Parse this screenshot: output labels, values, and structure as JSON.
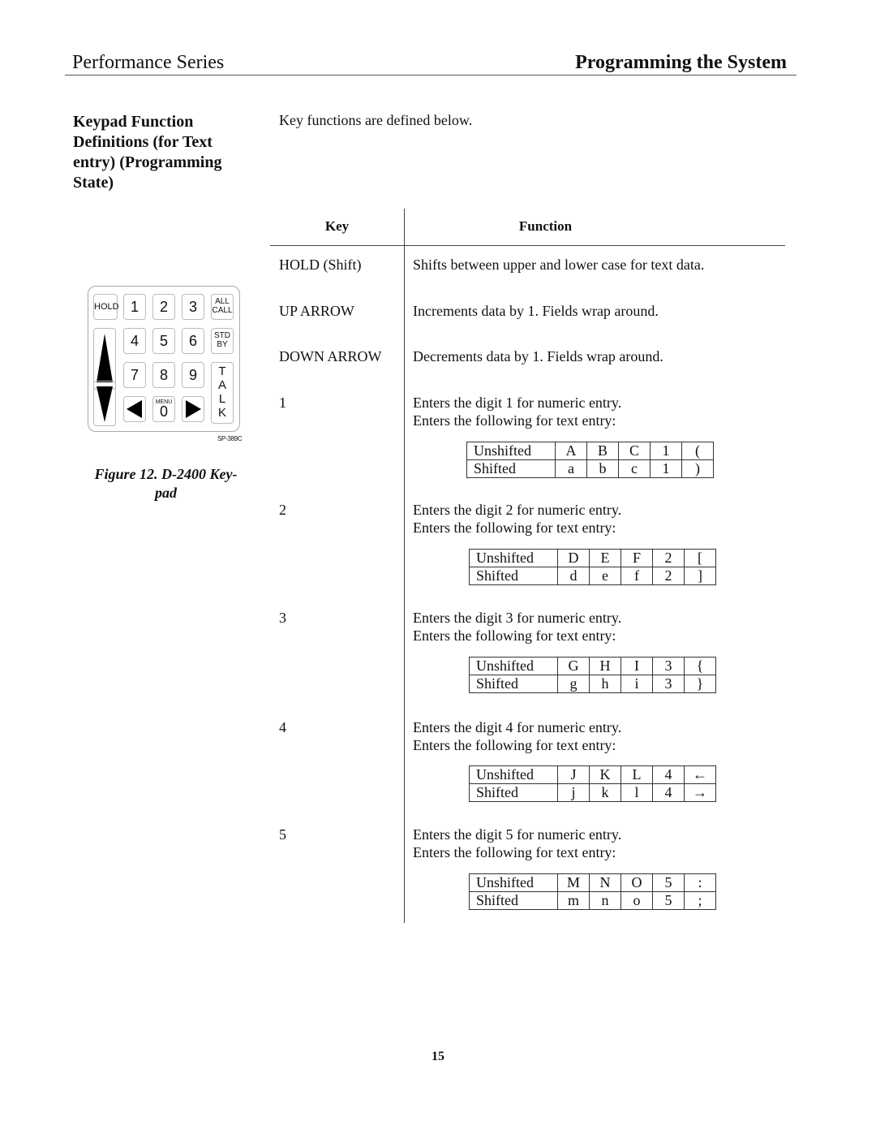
{
  "header": {
    "left": "Performance Series",
    "right": "Programming the System"
  },
  "section": {
    "title": "Keypad Function Definitions (for Text entry) (Programming State)",
    "intro": "Key functions are defined below."
  },
  "figure": {
    "caption_line1": "Figure 12.  D-2400 Key-",
    "caption_line2": "pad",
    "code": "SP-389C",
    "keys": {
      "hold": "HOLD",
      "d1": "1",
      "d2": "2",
      "d3": "3",
      "allcall_1": "ALL",
      "allcall_2": "CALL",
      "d4": "4",
      "d5": "5",
      "d6": "6",
      "stdby_1": "STD",
      "stdby_2": "BY",
      "d7": "7",
      "d8": "8",
      "d9": "9",
      "talk": [
        "T",
        "A",
        "L",
        "K"
      ],
      "menu": "MENU",
      "d0": "0"
    }
  },
  "table": {
    "col_key": "Key",
    "col_function": "Function",
    "rows": [
      {
        "key": "HOLD (Shift)",
        "function": "Shifts between upper and lower case for text data."
      },
      {
        "key": "UP ARROW",
        "function": "Increments data by 1.  Fields wrap around."
      },
      {
        "key": "DOWN ARROW",
        "function": "Decrements data by 1.  Fields wrap around."
      },
      {
        "key": "1",
        "function": "Enters the digit 1 for numeric entry.",
        "function2": "Enters the following for text entry:",
        "chars": {
          "unshifted": [
            "A",
            "B",
            "C",
            "1",
            "("
          ],
          "shifted": [
            "a",
            "b",
            "c",
            "1",
            ")"
          ]
        }
      },
      {
        "key": "2",
        "function": "Enters the digit 2 for numeric entry.",
        "function2": "Enters the following for text entry:",
        "chars": {
          "unshifted": [
            "D",
            "E",
            "F",
            "2",
            "["
          ],
          "shifted": [
            "d",
            "e",
            "f",
            "2",
            "]"
          ]
        }
      },
      {
        "key": "3",
        "function": "Enters the digit 3 for numeric entry.",
        "function2": "Enters the following for text entry:",
        "chars": {
          "unshifted": [
            "G",
            "H",
            "I",
            "3",
            "{"
          ],
          "shifted": [
            "g",
            "h",
            "i",
            "3",
            "}"
          ]
        }
      },
      {
        "key": "4",
        "function": "Enters the digit 4 for numeric entry.",
        "function2": "Enters the following for text entry:",
        "chars": {
          "unshifted": [
            "J",
            "K",
            "L",
            "4",
            "←"
          ],
          "shifted": [
            "j",
            "k",
            "l",
            "4",
            "→"
          ]
        }
      },
      {
        "key": "5",
        "function": "Enters the digit 5 for numeric entry.",
        "function2": "Enters the following for text entry:",
        "chars": {
          "unshifted": [
            "M",
            "N",
            "O",
            "5",
            ":"
          ],
          "shifted": [
            "m",
            "n",
            "o",
            "5",
            ";"
          ]
        }
      }
    ],
    "label_unshifted": "Unshifted",
    "label_shifted": "Shifted"
  },
  "page_number": "15"
}
